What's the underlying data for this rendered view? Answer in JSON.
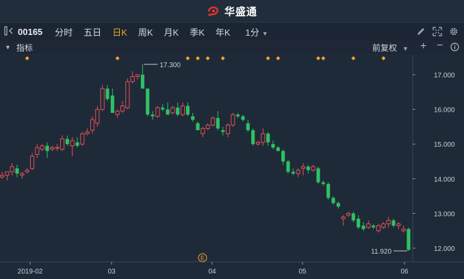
{
  "title": {
    "brand": "华盛通"
  },
  "toolbar": {
    "code": "00165",
    "periods": [
      "分时",
      "五日",
      "日K",
      "周K",
      "月K",
      "季K",
      "年K"
    ],
    "active_period": "日K",
    "minute_select": "1分"
  },
  "indicator_bar": {
    "label": "指标",
    "adjust_mode": "前复权"
  },
  "colors": {
    "up": "#e55156",
    "down": "#2fc164",
    "accent": "#f0a531",
    "bg": "#1f2a38"
  },
  "icons": [
    "brand-logo-icon",
    "sidebar-toggle-icon",
    "back-arrow-icon",
    "pencil-icon",
    "fullscreen-icon",
    "settings-gear-icon",
    "collapse-triangle-icon",
    "plus-icon",
    "minus-icon",
    "info-icon"
  ],
  "chart_data": {
    "type": "candlestick",
    "x_ticks": [
      "2019-02",
      "03",
      "04",
      "05",
      "06"
    ],
    "y_ticks": [
      "17.000",
      "16.000",
      "15.000",
      "14.000",
      "13.000",
      "12.000"
    ],
    "ylim": [
      11.75,
      17.35
    ],
    "max_label": "17.300",
    "min_label": "11.920",
    "event_marker": "E",
    "candles": [
      [
        14.05,
        14.2,
        14.0,
        14.1
      ],
      [
        14.1,
        14.2,
        13.95,
        14.2
      ],
      [
        14.2,
        14.45,
        14.1,
        14.35
      ],
      [
        14.3,
        14.4,
        14.05,
        14.15
      ],
      [
        14.1,
        14.2,
        14.0,
        14.15
      ],
      [
        14.2,
        14.3,
        14.15,
        14.25
      ],
      [
        14.3,
        14.75,
        14.25,
        14.65
      ],
      [
        14.7,
        15.0,
        14.6,
        14.9
      ],
      [
        14.85,
        15.0,
        14.8,
        14.95
      ],
      [
        14.95,
        15.05,
        14.6,
        14.8
      ],
      [
        14.85,
        14.95,
        14.8,
        14.9
      ],
      [
        14.9,
        15.0,
        14.8,
        14.9
      ],
      [
        14.85,
        15.25,
        14.8,
        15.15
      ],
      [
        15.15,
        15.25,
        14.95,
        15.0
      ],
      [
        14.95,
        15.2,
        14.65,
        15.1
      ],
      [
        15.05,
        15.2,
        14.9,
        14.95
      ],
      [
        15.0,
        15.35,
        14.95,
        15.3
      ],
      [
        15.3,
        15.45,
        15.25,
        15.35
      ],
      [
        15.4,
        15.8,
        15.3,
        15.7
      ],
      [
        15.6,
        16.1,
        15.5,
        16.0
      ],
      [
        16.0,
        16.7,
        15.95,
        16.6
      ],
      [
        16.6,
        16.7,
        16.25,
        16.3
      ],
      [
        16.4,
        16.6,
        15.9,
        15.9
      ],
      [
        15.85,
        16.0,
        15.75,
        15.95
      ],
      [
        15.95,
        16.25,
        15.9,
        16.1
      ],
      [
        16.05,
        16.9,
        16.0,
        16.8
      ],
      [
        16.8,
        17.1,
        16.75,
        16.95
      ],
      [
        16.95,
        17.0,
        16.85,
        17.0
      ],
      [
        17.0,
        17.3,
        16.6,
        16.6
      ],
      [
        16.6,
        16.6,
        15.8,
        15.85
      ],
      [
        15.85,
        15.95,
        15.7,
        15.8
      ],
      [
        15.8,
        16.1,
        15.75,
        16.05
      ],
      [
        16.05,
        16.15,
        15.95,
        16.0
      ],
      [
        16.0,
        16.2,
        15.85,
        15.85
      ],
      [
        15.9,
        16.1,
        15.85,
        16.05
      ],
      [
        16.05,
        16.2,
        15.8,
        15.85
      ],
      [
        15.85,
        16.2,
        15.8,
        16.1
      ],
      [
        16.1,
        16.2,
        15.8,
        15.85
      ],
      [
        15.8,
        15.9,
        15.65,
        15.7
      ],
      [
        15.6,
        15.65,
        15.4,
        15.4
      ],
      [
        15.3,
        15.5,
        15.2,
        15.45
      ],
      [
        15.45,
        15.6,
        15.4,
        15.55
      ],
      [
        15.55,
        15.8,
        15.5,
        15.75
      ],
      [
        15.75,
        15.95,
        15.4,
        15.45
      ],
      [
        15.4,
        15.5,
        15.25,
        15.35
      ],
      [
        15.3,
        15.6,
        15.2,
        15.55
      ],
      [
        15.55,
        15.9,
        15.5,
        15.85
      ],
      [
        15.85,
        15.9,
        15.75,
        15.8
      ],
      [
        15.8,
        15.85,
        15.65,
        15.7
      ],
      [
        15.6,
        15.7,
        15.35,
        15.4
      ],
      [
        15.4,
        15.45,
        14.95,
        15.0
      ],
      [
        15.0,
        15.1,
        14.95,
        15.05
      ],
      [
        15.05,
        15.45,
        14.95,
        15.3
      ],
      [
        15.3,
        15.35,
        14.95,
        15.05
      ],
      [
        15.0,
        15.1,
        14.85,
        14.9
      ],
      [
        14.9,
        14.95,
        14.8,
        14.8
      ],
      [
        14.8,
        14.85,
        14.4,
        14.5
      ],
      [
        14.5,
        14.55,
        14.15,
        14.2
      ],
      [
        14.2,
        14.3,
        14.1,
        14.15
      ],
      [
        14.15,
        14.3,
        14.05,
        14.25
      ],
      [
        14.3,
        14.45,
        14.1,
        14.35
      ],
      [
        14.35,
        14.4,
        14.15,
        14.25
      ],
      [
        14.25,
        14.4,
        14.2,
        14.35
      ],
      [
        14.3,
        14.35,
        13.85,
        13.9
      ],
      [
        13.9,
        13.95,
        13.8,
        13.85
      ],
      [
        13.85,
        13.9,
        13.4,
        13.45
      ],
      [
        13.45,
        13.5,
        13.25,
        13.3
      ],
      [
        13.3,
        13.35,
        13.15,
        13.2
      ],
      [
        12.85,
        12.95,
        12.65,
        12.9
      ],
      [
        12.95,
        13.05,
        12.9,
        13.0
      ],
      [
        13.0,
        13.05,
        12.75,
        12.8
      ],
      [
        12.85,
        12.95,
        12.55,
        12.6
      ],
      [
        12.65,
        12.75,
        12.5,
        12.55
      ],
      [
        12.6,
        12.8,
        12.55,
        12.7
      ],
      [
        12.65,
        12.7,
        12.55,
        12.6
      ],
      [
        12.5,
        12.7,
        12.45,
        12.65
      ],
      [
        12.6,
        12.75,
        12.55,
        12.7
      ],
      [
        12.7,
        12.9,
        12.6,
        12.8
      ],
      [
        12.8,
        12.85,
        12.6,
        12.65
      ],
      [
        12.65,
        12.75,
        12.55,
        12.7
      ],
      [
        12.5,
        12.65,
        12.45,
        12.55
      ],
      [
        12.55,
        12.6,
        11.92,
        11.95
      ]
    ],
    "event_diamonds": [
      5,
      23,
      37,
      39,
      41,
      44,
      53,
      55,
      63,
      64,
      70,
      76
    ]
  }
}
